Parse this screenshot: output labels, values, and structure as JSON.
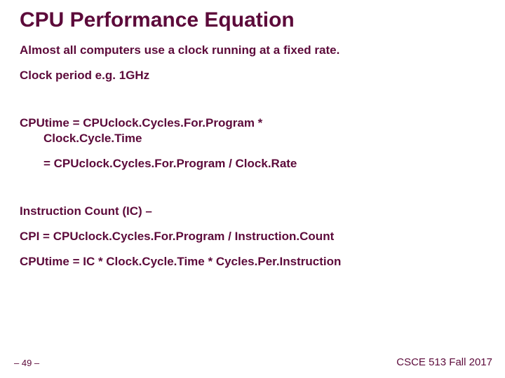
{
  "title": "CPU Performance Equation",
  "lines": {
    "intro": "Almost all computers use a clock running at a fixed rate.",
    "clock_period": "Clock period   e.g. 1GHz",
    "cputime_eq1_a": "CPUtime = CPUclock.Cycles.For.Program *",
    "cputime_eq1_b": "Clock.Cycle.Time",
    "cputime_eq2": "= CPUclock.Cycles.For.Program / Clock.Rate",
    "ic": "Instruction Count (IC) –",
    "cpi": "CPI = CPUclock.Cycles.For.Program / Instruction.Count",
    "cputime_eq3": "CPUtime = IC * Clock.Cycle.Time * Cycles.Per.Instruction"
  },
  "footer": {
    "page": "– 49 –",
    "course": "CSCE 513 Fall 2017"
  }
}
